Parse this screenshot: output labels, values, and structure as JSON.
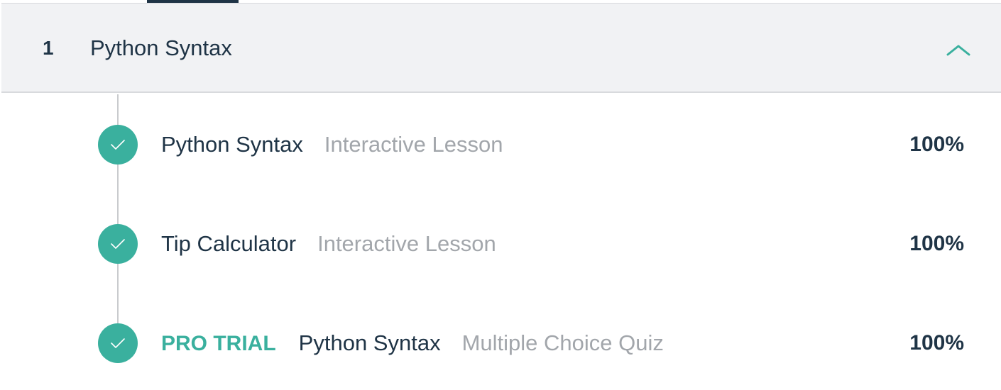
{
  "section": {
    "number": "1",
    "title": "Python Syntax",
    "expanded": true
  },
  "lessons": [
    {
      "badge": "",
      "title": "Python Syntax",
      "type": "Interactive Lesson",
      "progress": "100%",
      "completed": true
    },
    {
      "badge": "",
      "title": "Tip Calculator",
      "type": "Interactive Lesson",
      "progress": "100%",
      "completed": true
    },
    {
      "badge": "PRO TRIAL",
      "title": "Python Syntax",
      "type": "Multiple Choice Quiz",
      "progress": "100%",
      "completed": true
    }
  ],
  "icons": {
    "collapse": "chevron-up-icon",
    "complete": "check-icon"
  },
  "colors": {
    "accent": "#3ab09e",
    "text_dark": "#1f3446",
    "text_muted": "#a2a6ab",
    "header_bg": "#f1f2f4",
    "timeline": "#c9cbce"
  }
}
